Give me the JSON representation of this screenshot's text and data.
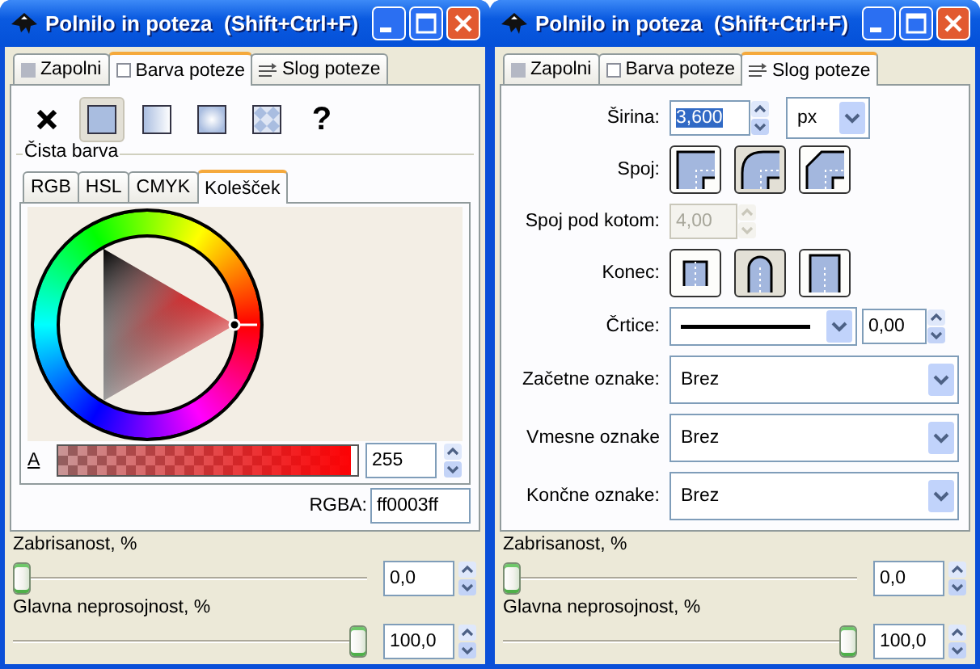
{
  "windows": [
    {
      "title": "Polnilo in poteza  (Shift+Ctrl+F)",
      "tabs": [
        {
          "label": "Zapolni",
          "kind": "fill",
          "selected": false
        },
        {
          "label": "Barva poteze",
          "kind": "stroke",
          "selected": true
        },
        {
          "label": "Slog poteze",
          "kind": "style",
          "selected": false
        }
      ],
      "page": {
        "kind": "paint",
        "paint_types": [
          {
            "kind": "none",
            "selected": false
          },
          {
            "kind": "flat",
            "selected": true
          },
          {
            "kind": "linear",
            "selected": false
          },
          {
            "kind": "radial",
            "selected": false
          },
          {
            "kind": "pattern",
            "selected": false
          },
          {
            "kind": "unset",
            "label": "?",
            "selected": false
          }
        ],
        "group_label": "Čista barva",
        "color_tabs": [
          {
            "label": "RGB",
            "selected": false
          },
          {
            "label": "HSL",
            "selected": false
          },
          {
            "label": "CMYK",
            "selected": false
          },
          {
            "label": "Kolešček",
            "selected": true
          }
        ],
        "alpha": {
          "label": "A",
          "level": 1,
          "value": "255"
        },
        "rgba": {
          "label": "RGBA:",
          "value": "ff0003ff"
        }
      },
      "blur": {
        "label": "Zabrisanost, %",
        "level": 0,
        "value": "0,0"
      },
      "opacity": {
        "label": "Glavna neprosojnost, %",
        "level": 1,
        "value": "100,0"
      }
    },
    {
      "title": "Polnilo in poteza  (Shift+Ctrl+F)",
      "tabs": [
        {
          "label": "Zapolni",
          "kind": "fill",
          "selected": false
        },
        {
          "label": "Barva poteze",
          "kind": "stroke",
          "selected": false
        },
        {
          "label": "Slog poteze",
          "kind": "style",
          "selected": true
        }
      ],
      "page": {
        "kind": "style",
        "width": {
          "label": "Širina:",
          "value": "3,600",
          "text_selected": true,
          "unit": "px"
        },
        "join": {
          "label": "Spoj:",
          "options": [
            {
              "kind": "miter",
              "selected": false
            },
            {
              "kind": "round",
              "selected": true
            },
            {
              "kind": "bevel",
              "selected": false
            }
          ]
        },
        "miter": {
          "label": "Spoj pod kotom:",
          "value": "4,00",
          "disabled": true
        },
        "cap": {
          "label": "Konec:",
          "options": [
            {
              "kind": "butt",
              "selected": false
            },
            {
              "kind": "round",
              "selected": true
            },
            {
              "kind": "square",
              "selected": false
            }
          ]
        },
        "dash": {
          "label": "Črtice:",
          "value": "0,00"
        },
        "markers": [
          {
            "label": "Začetne oznake:",
            "value": "Brez"
          },
          {
            "label": "Vmesne oznake",
            "value": "Brez"
          },
          {
            "label": "Končne oznake:",
            "value": "Brez"
          }
        ]
      },
      "blur": {
        "label": "Zabrisanost, %",
        "level": 0,
        "value": "0,0"
      },
      "opacity": {
        "label": "Glavna neprosojnost, %",
        "level": 1,
        "value": "100,0"
      }
    }
  ]
}
